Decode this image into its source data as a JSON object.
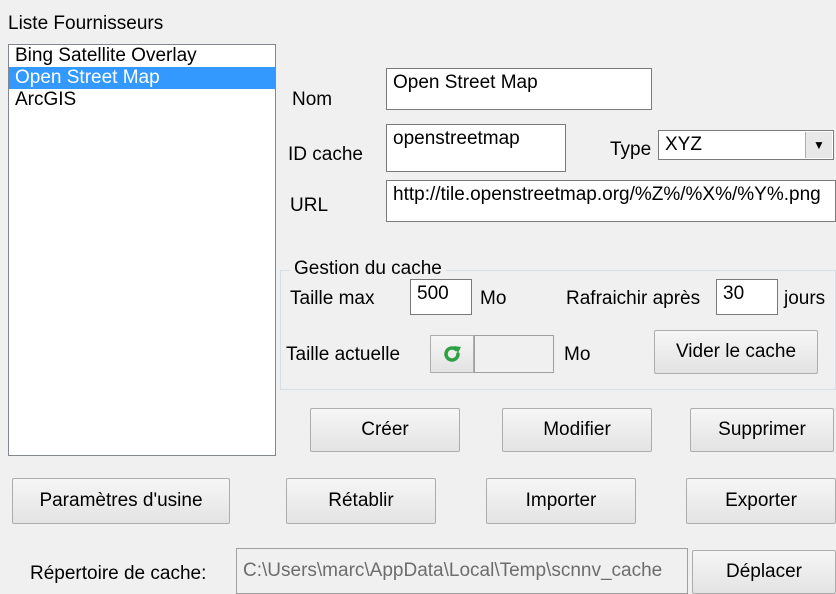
{
  "providers": {
    "title": "Liste Fournisseurs",
    "items": [
      {
        "label": "Bing Satellite Overlay",
        "selected": false
      },
      {
        "label": "Open Street Map",
        "selected": true
      },
      {
        "label": "ArcGIS",
        "selected": false
      }
    ]
  },
  "form": {
    "nom_label": "Nom",
    "nom_value": "Open Street Map",
    "id_cache_label": "ID cache",
    "id_cache_value": "openstreetmap",
    "type_label": "Type",
    "type_value": "XYZ",
    "url_label": "URL",
    "url_value": "http://tile.openstreetmap.org/%Z%/%X%/%Y%.png"
  },
  "cache": {
    "group_title": "Gestion du cache",
    "taille_max_label": "Taille max",
    "taille_max_value": "500",
    "taille_max_unit": "Mo",
    "rafraichir_label": "Rafraichir après",
    "rafraichir_value": "30",
    "rafraichir_unit": "jours",
    "taille_actuelle_label": "Taille actuelle",
    "taille_actuelle_value": "",
    "taille_actuelle_unit": "Mo",
    "vider_button": "Vider le cache"
  },
  "actions": {
    "creer": "Créer",
    "modifier": "Modifier",
    "supprimer": "Supprimer"
  },
  "bottom": {
    "parametres": "Paramètres d'usine",
    "retablir": "Rétablir",
    "importer": "Importer",
    "exporter": "Exporter"
  },
  "directory": {
    "label": "Répertoire de cache:",
    "value": "C:\\Users\\marc\\AppData\\Local\\Temp\\scnnv_cache",
    "deplacer_button": "Déplacer"
  },
  "colors": {
    "selection": "#3399ff",
    "refresh_icon": "#2ea043"
  },
  "icons": {
    "refresh": "refresh-icon",
    "dropdown": "chevron-down-icon"
  }
}
